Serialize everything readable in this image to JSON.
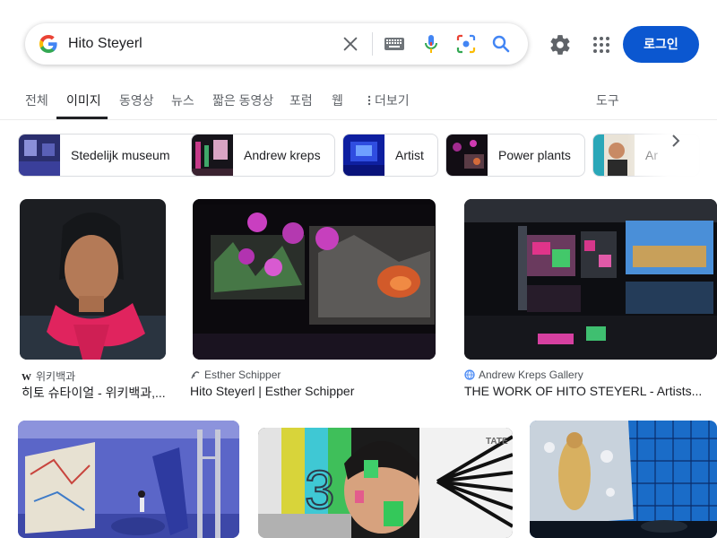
{
  "search": {
    "query": "Hito Steyerl",
    "login_label": "로그인"
  },
  "tabs": [
    {
      "label": "전체"
    },
    {
      "label": "이미지"
    },
    {
      "label": "동영상"
    },
    {
      "label": "뉴스"
    },
    {
      "label": "짧은 동영상"
    },
    {
      "label": "포럼"
    },
    {
      "label": "웹"
    },
    {
      "label": "더보기"
    },
    {
      "label": "도구"
    }
  ],
  "chips": [
    {
      "label": "Stedelijk museum"
    },
    {
      "label": "Andrew kreps"
    },
    {
      "label": "Artist"
    },
    {
      "label": "Power plants"
    },
    {
      "label": "Ar"
    }
  ],
  "results": [
    {
      "source": "위키백과",
      "title": "히토 슈타이얼 - 위키백과,...",
      "source_icon": "wikipedia-w-icon"
    },
    {
      "source": "Esther Schipper",
      "title": "Hito Steyerl | Esther Schipper",
      "source_icon": "site-icon"
    },
    {
      "source": "Andrew Kreps Gallery",
      "title": "THE WORK OF HITO STEYERL - Artists...",
      "source_icon": "globe-icon"
    },
    {
      "watermark": "TATE"
    }
  ],
  "colors": {
    "accent": "#0b57d0",
    "text": "#202124",
    "muted": "#5f6368"
  },
  "icons": [
    "google-g-icon",
    "clear-icon",
    "keyboard-icon",
    "mic-icon",
    "lens-icon",
    "search-icon",
    "gear-icon",
    "apps-icon",
    "chevron-right-icon"
  ]
}
